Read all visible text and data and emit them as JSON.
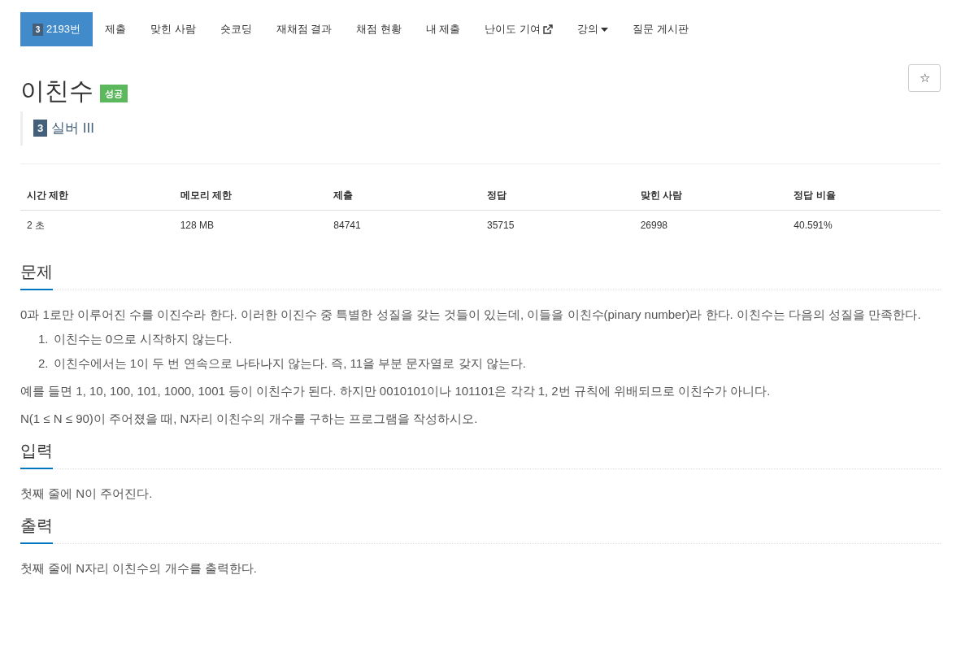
{
  "nav": [
    {
      "label": "2193번",
      "badge": "3",
      "selected": true
    },
    {
      "label": "제출",
      "selected": false
    },
    {
      "label": "맞힌 사람",
      "selected": false
    },
    {
      "label": "숏코딩",
      "selected": false
    },
    {
      "label": "재채점 결과",
      "selected": false
    },
    {
      "label": "채점 현황",
      "selected": false
    },
    {
      "label": "내 제출",
      "selected": false
    },
    {
      "label": "난이도 기여",
      "kind": "external",
      "selected": false
    },
    {
      "label": "강의",
      "kind": "dropdown",
      "selected": false
    },
    {
      "label": "질문 게시판",
      "selected": false
    }
  ],
  "title": "이친수",
  "status_badge": "성공",
  "star_button": "☆",
  "tier": {
    "badge": "3",
    "label": "실버 III"
  },
  "stats": {
    "columns": [
      "시간 제한",
      "메모리 제한",
      "제출",
      "정답",
      "맞힌 사람",
      "정답 비율"
    ],
    "row": [
      "2 초",
      "128 MB",
      "84741",
      "35715",
      "26998",
      "40.591%"
    ]
  },
  "sections": [
    {
      "heading": "문제",
      "blocks": [
        {
          "kind": "p",
          "text": "0과 1로만 이루어진 수를 이진수라 한다. 이러한 이진수 중 특별한 성질을 갖는 것들이 있는데, 이들을 이친수(pinary number)라 한다. 이친수는 다음의 성질을 만족한다."
        },
        {
          "kind": "ol",
          "items": [
            "이친수는 0으로 시작하지 않는다.",
            "이친수에서는 1이 두 번 연속으로 나타나지 않는다. 즉, 11을 부분 문자열로 갖지 않는다."
          ],
          "markers": [
            "1.",
            "2."
          ]
        },
        {
          "kind": "p",
          "text": "예를 들면 1, 10, 100, 101, 1000, 1001 등이 이친수가 된다. 하지만 0010101이나 101101은 각각 1, 2번 규칙에 위배되므로 이친수가 아니다."
        },
        {
          "kind": "p",
          "text": "N(1 ≤ N ≤ 90)이 주어졌을 때, N자리 이친수의 개수를 구하는 프로그램을 작성하시오."
        }
      ]
    },
    {
      "heading": "입력",
      "blocks": [
        {
          "kind": "p",
          "text": "첫째 줄에 N이 주어진다."
        }
      ]
    },
    {
      "heading": "출력",
      "blocks": [
        {
          "kind": "p",
          "text": "첫째 줄에 N자리 이친수의 개수를 출력한다."
        }
      ]
    }
  ]
}
